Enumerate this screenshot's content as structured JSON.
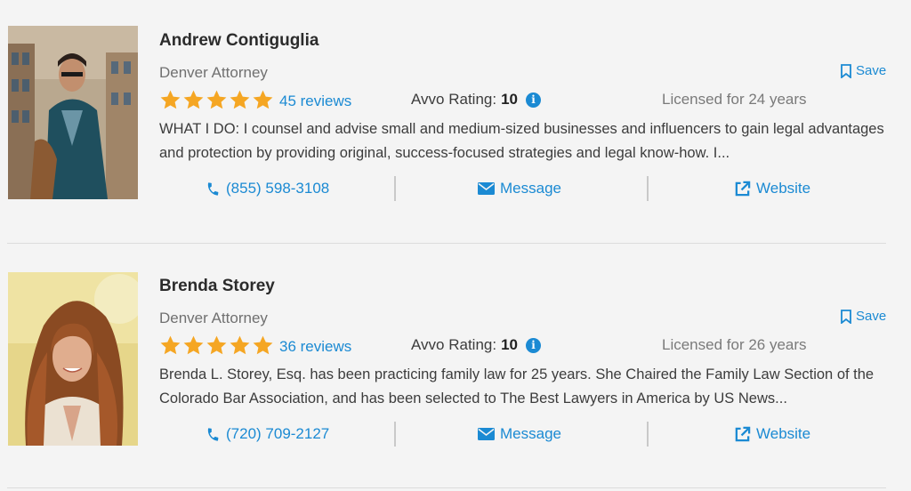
{
  "results": [
    {
      "name": "Andrew Contiguglia",
      "subtitle": "Denver Attorney",
      "save_label": "Save",
      "reviews": "45 reviews",
      "rating_label": "Avvo Rating:",
      "rating_value": "10",
      "licensed": "Licensed for 24 years",
      "description": "WHAT I DO: I counsel and advise small and medium-sized businesses and influencers to gain legal advantages and protection by providing original, success-focused strategies and legal know-how. I...",
      "phone": "(855) 598-3108",
      "message_label": "Message",
      "website_label": "Website",
      "stars": 5
    },
    {
      "name": "Brenda Storey",
      "subtitle": "Denver Attorney",
      "save_label": "Save",
      "reviews": "36 reviews",
      "rating_label": "Avvo Rating:",
      "rating_value": "10",
      "licensed": "Licensed for 26 years",
      "description": "Brenda L. Storey, Esq. has been practicing family law for 25 years. She Chaired the Family Law Section of the Colorado Bar Association, and has been selected to The Best Lawyers in America by US News...",
      "phone": "(720) 709-2127",
      "message_label": "Message",
      "website_label": "Website",
      "stars": 5
    }
  ],
  "colors": {
    "accent": "#1b8ad3",
    "star": "#f5a623",
    "background": "#f4f4f4"
  },
  "icons": {
    "save": "bookmark-icon",
    "rating_info": "info-icon",
    "phone": "phone-icon",
    "message": "envelope-icon",
    "website": "external-link-icon",
    "rating": "star-icon"
  }
}
